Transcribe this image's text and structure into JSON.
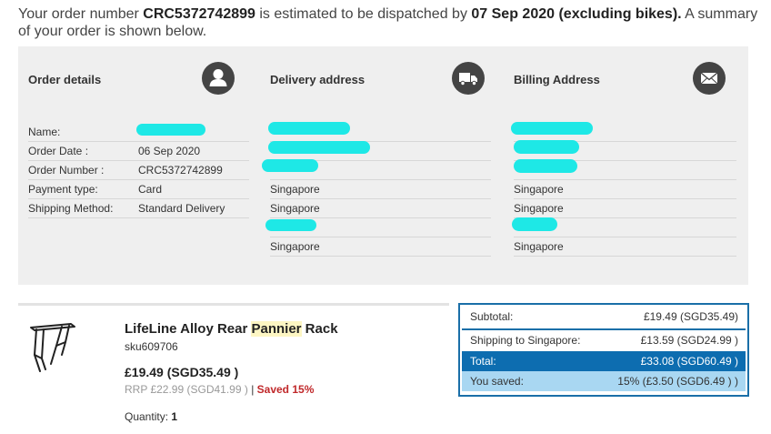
{
  "headline": {
    "prefix": "Your order number ",
    "order_number": "CRC5372742899",
    "middle": " is estimated to be dispatched by ",
    "dispatch": "07 Sep 2020 (excluding bikes).",
    "suffix": "  A summary of your order is shown below."
  },
  "order_details": {
    "title": "Order details",
    "rows": [
      {
        "label": "Name:",
        "value": ""
      },
      {
        "label": "Order Date :",
        "value": "06 Sep 2020"
      },
      {
        "label": "Order Number :",
        "value": "CRC5372742899"
      },
      {
        "label": "Payment type:",
        "value": "Card"
      },
      {
        "label": "Shipping Method:",
        "value": "Standard Delivery"
      }
    ]
  },
  "delivery": {
    "title": "Delivery address",
    "lines": [
      "",
      "",
      "",
      "Singapore",
      "Singapore",
      "",
      "Singapore"
    ]
  },
  "billing": {
    "title": "Billing Address",
    "lines": [
      "",
      "",
      "",
      "Singapore",
      "Singapore",
      "",
      "Singapore"
    ]
  },
  "product": {
    "title_pre": "LifeLine Alloy Rear ",
    "title_hl": "Pannier",
    "title_post": " Rack",
    "sku": "sku609706",
    "price": "£19.49 (SGD35.49 )",
    "rrp": "RRP  £22.99 (SGD41.99 )",
    "sep": " | ",
    "saved": "Saved  15%",
    "qty_label": "Quantity: ",
    "qty_value": "1"
  },
  "summary": {
    "subtotal_label": "Subtotal:",
    "subtotal_value": "£19.49 (SGD35.49)",
    "shipping_label": "Shipping to  Singapore:",
    "shipping_value": "£13.59 (SGD24.99 )",
    "total_label": "Total:",
    "total_value": "£33.08 (SGD60.49 )",
    "saved_label": "You saved:",
    "saved_value": "15% (£3.50 (SGD6.49 ) )"
  },
  "colors": {
    "panel_bg": "#efefef",
    "summary_border": "#1a6fa8",
    "total_bg": "#0d6db0",
    "saved_bg": "#a9d7f2",
    "saved_text": "#c0282a",
    "redaction": "#1ee8e6"
  },
  "icons": [
    "user-icon",
    "truck-icon",
    "envelope-icon",
    "pannier-rack-image"
  ]
}
